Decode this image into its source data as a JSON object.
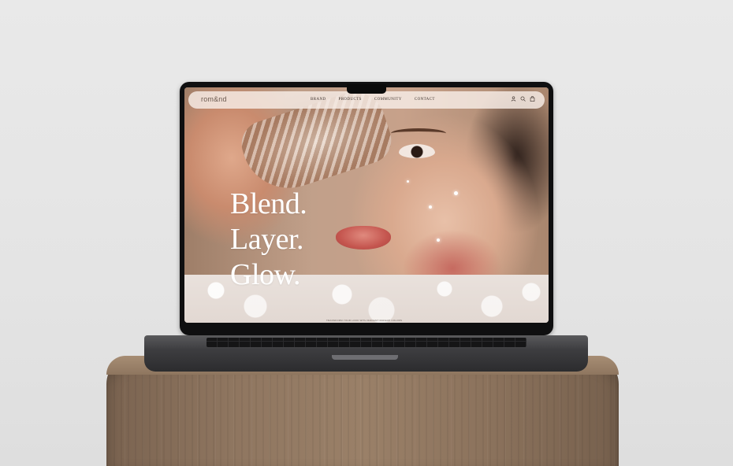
{
  "site": {
    "logo": "rom&nd",
    "nav": [
      "BRAND",
      "PRODUCTS",
      "COMMUNITY",
      "CONTACT"
    ],
    "icons": [
      "user-icon",
      "search-icon",
      "bag-icon"
    ]
  },
  "hero": {
    "headline": [
      "Blend.",
      "Layer.",
      "Glow."
    ],
    "footnote": "TRANSFORM YOUR LOOK WITH RADIANT MAKEUP COLORS"
  },
  "colors": {
    "nav_bg": "#f8eee8",
    "text_dark": "#3a2f2a",
    "headline": "#ffffff"
  }
}
